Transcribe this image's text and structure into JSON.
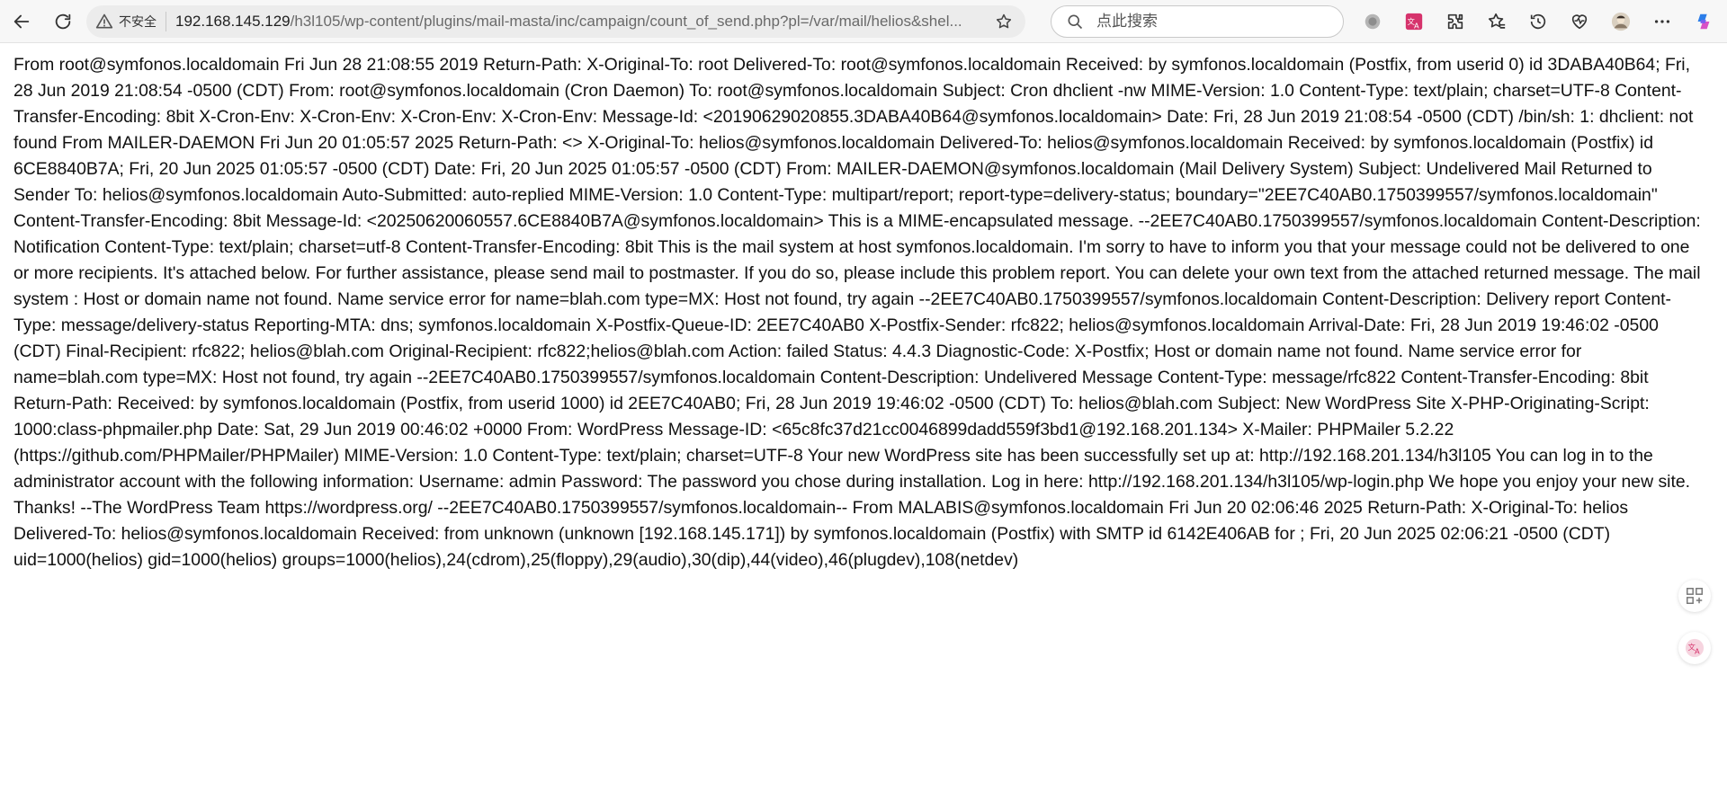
{
  "browser": {
    "security_label": "不安全",
    "url_host": "192.168.145.129",
    "url_path": "/h3l105/wp-content/plugins/mail-masta/inc/campaign/count_of_send.php?pl=/var/mail/helios&shel...",
    "search_placeholder": "点此搜索",
    "icons": [
      "back-icon",
      "reload-icon",
      "warning-icon",
      "favorite-star-icon",
      "search-icon",
      "tracking-prevention-icon",
      "translate-icon",
      "extensions-icon",
      "favorites-icon",
      "history-icon",
      "browser-essentials-icon",
      "profile-avatar",
      "more-icon",
      "copilot-icon",
      "add-to-sidebar-icon",
      "translate-float-icon"
    ],
    "colors": {
      "translate": "#d6336c",
      "warning": "#555555",
      "copilot_a": "#2b7de9",
      "copilot_b": "#d94fc6"
    }
  },
  "page": {
    "body_text": "From root@symfonos.localdomain Fri Jun 28 21:08:55 2019 Return-Path: X-Original-To: root Delivered-To: root@symfonos.localdomain Received: by symfonos.localdomain (Postfix, from userid 0) id 3DABA40B64; Fri, 28 Jun 2019 21:08:54 -0500 (CDT) From: root@symfonos.localdomain (Cron Daemon) To: root@symfonos.localdomain Subject: Cron dhclient -nw MIME-Version: 1.0 Content-Type: text/plain; charset=UTF-8 Content-Transfer-Encoding: 8bit X-Cron-Env: X-Cron-Env: X-Cron-Env: X-Cron-Env: Message-Id: <20190629020855.3DABA40B64@symfonos.localdomain> Date: Fri, 28 Jun 2019 21:08:54 -0500 (CDT) /bin/sh: 1: dhclient: not found From MAILER-DAEMON Fri Jun 20 01:05:57 2025 Return-Path: <> X-Original-To: helios@symfonos.localdomain Delivered-To: helios@symfonos.localdomain Received: by symfonos.localdomain (Postfix) id 6CE8840B7A; Fri, 20 Jun 2025 01:05:57 -0500 (CDT) Date: Fri, 20 Jun 2025 01:05:57 -0500 (CDT) From: MAILER-DAEMON@symfonos.localdomain (Mail Delivery System) Subject: Undelivered Mail Returned to Sender To: helios@symfonos.localdomain Auto-Submitted: auto-replied MIME-Version: 1.0 Content-Type: multipart/report; report-type=delivery-status; boundary=\"2EE7C40AB0.1750399557/symfonos.localdomain\" Content-Transfer-Encoding: 8bit Message-Id: <20250620060557.6CE8840B7A@symfonos.localdomain> This is a MIME-encapsulated message. --2EE7C40AB0.1750399557/symfonos.localdomain Content-Description: Notification Content-Type: text/plain; charset=utf-8 Content-Transfer-Encoding: 8bit This is the mail system at host symfonos.localdomain. I'm sorry to have to inform you that your message could not be delivered to one or more recipients. It's attached below. For further assistance, please send mail to postmaster. If you do so, please include this problem report. You can delete your own text from the attached returned message. The mail system : Host or domain name not found. Name service error for name=blah.com type=MX: Host not found, try again --2EE7C40AB0.1750399557/symfonos.localdomain Content-Description: Delivery report Content-Type: message/delivery-status Reporting-MTA: dns; symfonos.localdomain X-Postfix-Queue-ID: 2EE7C40AB0 X-Postfix-Sender: rfc822; helios@symfonos.localdomain Arrival-Date: Fri, 28 Jun 2019 19:46:02 -0500 (CDT) Final-Recipient: rfc822; helios@blah.com Original-Recipient: rfc822;helios@blah.com Action: failed Status: 4.4.3 Diagnostic-Code: X-Postfix; Host or domain name not found. Name service error for name=blah.com type=MX: Host not found, try again --2EE7C40AB0.1750399557/symfonos.localdomain Content-Description: Undelivered Message Content-Type: message/rfc822 Content-Transfer-Encoding: 8bit Return-Path: Received: by symfonos.localdomain (Postfix, from userid 1000) id 2EE7C40AB0; Fri, 28 Jun 2019 19:46:02 -0500 (CDT) To: helios@blah.com Subject: New WordPress Site X-PHP-Originating-Script: 1000:class-phpmailer.php Date: Sat, 29 Jun 2019 00:46:02 +0000 From: WordPress Message-ID: <65c8fc37d21cc0046899dadd559f3bd1@192.168.201.134> X-Mailer: PHPMailer 5.2.22 (https://github.com/PHPMailer/PHPMailer) MIME-Version: 1.0 Content-Type: text/plain; charset=UTF-8 Your new WordPress site has been successfully set up at: http://192.168.201.134/h3l105 You can log in to the administrator account with the following information: Username: admin Password: The password you chose during installation. Log in here: http://192.168.201.134/h3l105/wp-login.php We hope you enjoy your new site. Thanks! --The WordPress Team https://wordpress.org/ --2EE7C40AB0.1750399557/symfonos.localdomain-- From MALABIS@symfonos.localdomain Fri Jun 20 02:06:46 2025 Return-Path: X-Original-To: helios Delivered-To: helios@symfonos.localdomain Received: from unknown (unknown [192.168.145.171]) by symfonos.localdomain (Postfix) with SMTP id 6142E406AB for ; Fri, 20 Jun 2025 02:06:21 -0500 (CDT) uid=1000(helios) gid=1000(helios) groups=1000(helios),24(cdrom),25(floppy),29(audio),30(dip),44(video),46(plugdev),108(netdev)"
  }
}
